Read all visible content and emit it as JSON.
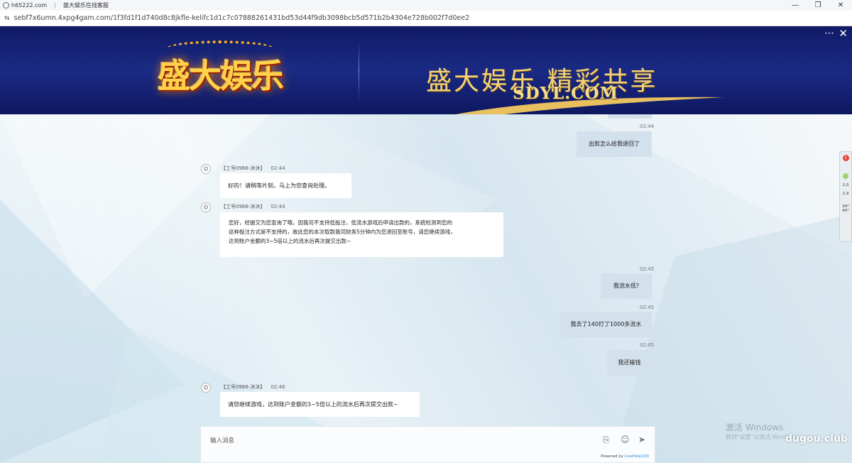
{
  "browser": {
    "site_name": "h65222.com",
    "tab_title": "盛大娱乐在线客服",
    "url": "sebf7x6umn.4xpg4gam.com/1f3fd1f1d740d8c8jkfle-kelifc1d1c7c07888261431bd53d44f9db3098bcb5d571b2b4304e728b002f7d0ee2",
    "window_controls": [
      "—",
      "❐",
      "✕"
    ]
  },
  "banner": {
    "menu_icon": "⋯",
    "close_icon": "✕",
    "logo_text": "盛大娱乐",
    "slogan": "盛大娱乐 精彩共享",
    "domain": "SDYL.COM"
  },
  "chat": {
    "messages": [
      {
        "time": "02:44",
        "text": "出款怎么给我退回了"
      },
      {
        "agent": "【工号0966-沐沐】",
        "time": "02:44",
        "text": "好的！请稍等片刻，马上为您查询处理。"
      },
      {
        "agent": "【工号0966-沐沐】",
        "time": "02:44",
        "lines": [
          "您好，经提交为您查询了哦，因我司不支持低投注，低流水游戏后申请出款的，系统检测到您的",
          "这种投注方式是不支持的，故此您的本次取款我司财务5分钟内为您退回至账号，请您继续游戏，",
          "达到账户金额的3~5倍以上的流水后再次提交出款~"
        ]
      },
      {
        "time": "02:45",
        "text": "我流水低?"
      },
      {
        "time": "02:45",
        "text": "我去了140打了1000多流水"
      },
      {
        "time": "02:45",
        "text": "我还输钱"
      },
      {
        "agent": "【工号0966-沐沐】",
        "time": "02:46",
        "text": "请您继续游戏，达到账户金额的3~5倍以上的流水后再次提交出款~"
      }
    ],
    "input_placeholder": "输入消息",
    "powered_prefix": "Powered by ",
    "powered_brand": "LiveHelp100",
    "icons": {
      "attach": "attach-icon",
      "emoji": "emoji-icon",
      "send": "send-icon"
    }
  },
  "side_widget": {
    "badge": "1",
    "line1": "2.0",
    "line2": "1.9",
    "line3": "34°",
    "line4": "40°"
  },
  "watermark": {
    "title": "激活 Windows",
    "subtitle": "转到\"设置\"以激活 Windows。",
    "site": "dugou.club"
  }
}
